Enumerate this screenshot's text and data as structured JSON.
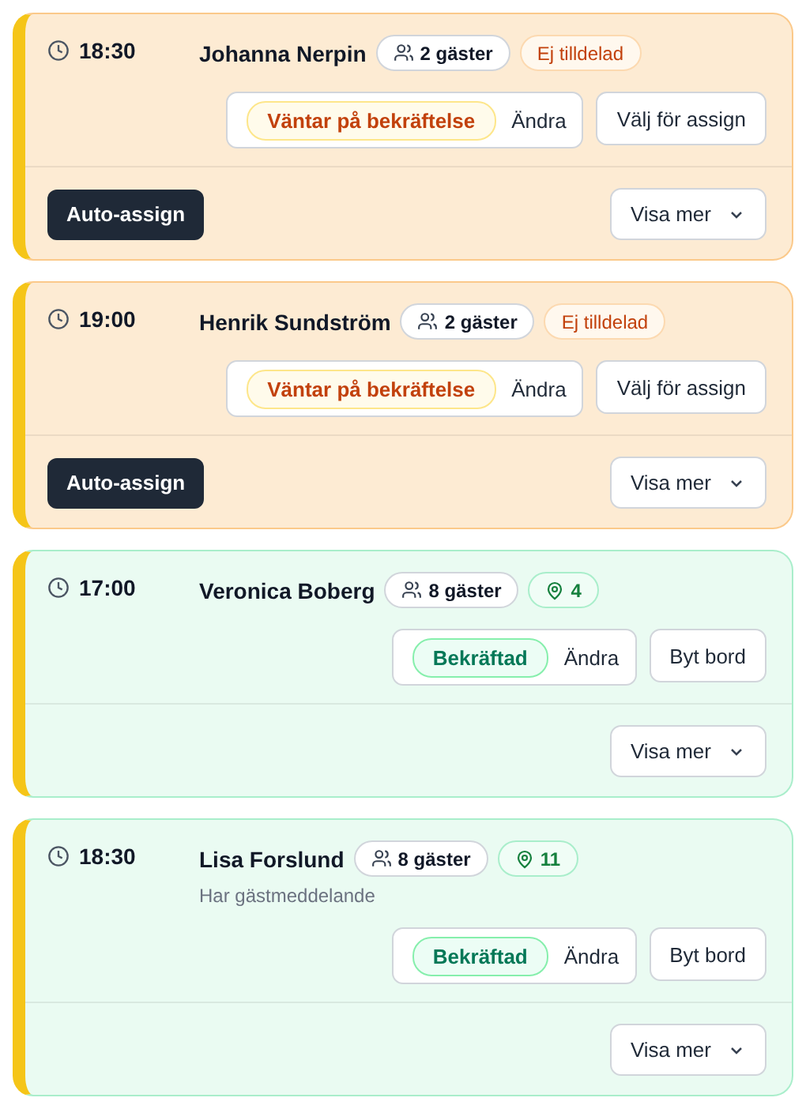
{
  "reservations": [
    {
      "kind": "pending",
      "time": "18:30",
      "name": "Johanna Nerpin",
      "guests": "2 gäster",
      "badge": {
        "kind": "unassigned",
        "text": "Ej tilldelad"
      },
      "status": "Väntar på bekräftelse",
      "change": "Ändra",
      "action": "Välj för assign",
      "auto_assign": "Auto-assign",
      "more": "Visa mer"
    },
    {
      "kind": "pending",
      "time": "19:00",
      "name": "Henrik Sundström",
      "guests": "2 gäster",
      "badge": {
        "kind": "unassigned",
        "text": "Ej tilldelad"
      },
      "status": "Väntar på bekräftelse",
      "change": "Ändra",
      "action": "Välj för assign",
      "auto_assign": "Auto-assign",
      "more": "Visa mer"
    },
    {
      "kind": "confirmed",
      "time": "17:00",
      "name": "Veronica Boberg",
      "guests": "8 gäster",
      "badge": {
        "kind": "table",
        "text": "4"
      },
      "status": "Bekräftad",
      "change": "Ändra",
      "action": "Byt bord",
      "more": "Visa mer"
    },
    {
      "kind": "confirmed",
      "time": "18:30",
      "name": "Lisa Forslund",
      "guests": "8 gäster",
      "badge": {
        "kind": "table",
        "text": "11"
      },
      "note": "Har gästmeddelande",
      "status": "Bekräftad",
      "change": "Ändra",
      "action": "Byt bord",
      "more": "Visa mer"
    }
  ]
}
